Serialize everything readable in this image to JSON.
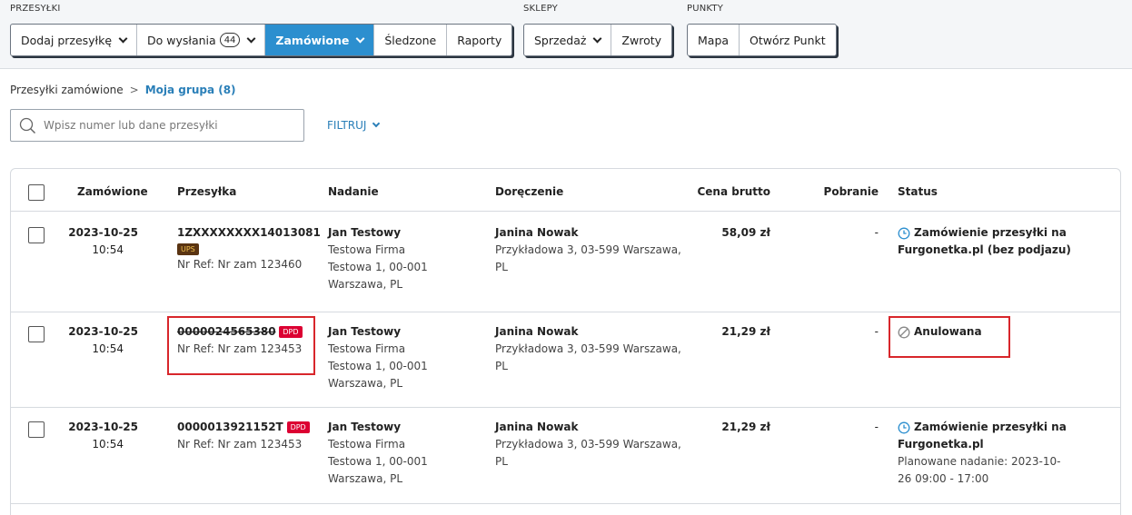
{
  "topbar": {
    "groups": [
      {
        "label": "PRZESYŁKI",
        "buttons": [
          "Dodaj przesyłkę",
          "Do wysłania",
          "Zamówione",
          "Śledzone",
          "Raporty"
        ],
        "to_send_count": "44"
      },
      {
        "label": "SKLEPY",
        "buttons": [
          "Sprzedaż",
          "Zwroty"
        ]
      },
      {
        "label": "PUNKTY",
        "buttons": [
          "Mapa",
          "Otwórz Punkt"
        ]
      }
    ]
  },
  "breadcrumb": {
    "parent": "Przesyłki zamówione",
    "separator": ">",
    "current": "Moja grupa (8)"
  },
  "search": {
    "placeholder": "Wpisz numer lub dane przesyłki"
  },
  "filter": {
    "label": "FILTRUJ"
  },
  "table": {
    "headers": [
      "Zamówione",
      "Przesyłka",
      "Nadanie",
      "Doręczenie",
      "Cena brutto",
      "Pobranie",
      "Status"
    ],
    "rows": [
      {
        "date": "2023-10-25",
        "time": "10:54",
        "tracking": "1ZXXXXXXXX14013081",
        "carrier": "UPS",
        "ref": "Nr Ref: Nr zam 123460",
        "sender": [
          "Jan Testowy",
          "Testowa Firma",
          "Testowa 1, 00-001",
          "Warszawa, PL"
        ],
        "recipient": [
          "Janina Nowak",
          "Przykładowa 3, 03-599 Warszawa,",
          "PL"
        ],
        "price": "58,09 zł",
        "cod": "-",
        "status": [
          "Zamówienie przesyłki na",
          "Furgonetka.pl (bez podjazu)"
        ]
      },
      {
        "date": "2023-10-25",
        "time": "10:54",
        "tracking": "0000024565380",
        "carrier": "DPD",
        "ref": "Nr Ref: Nr zam 123453",
        "sender": [
          "Jan Testowy",
          "Testowa Firma",
          "Testowa 1, 00-001",
          "Warszawa, PL"
        ],
        "recipient": [
          "Janina Nowak",
          "Przykładowa 3, 03-599 Warszawa,",
          "PL"
        ],
        "price": "21,29 zł",
        "cod": "-",
        "status": [
          "Anulowana"
        ]
      },
      {
        "date": "2023-10-25",
        "time": "10:54",
        "tracking": "0000013921152T",
        "carrier": "DPD",
        "ref": "Nr Ref: Nr zam 123453",
        "sender": [
          "Jan Testowy",
          "Testowa Firma",
          "Testowa 1, 00-001",
          "Warszawa, PL"
        ],
        "recipient": [
          "Janina Nowak",
          "Przykładowa 3, 03-599 Warszawa,",
          "PL"
        ],
        "price": "21,29 zł",
        "cod": "-",
        "status": [
          "Zamówienie przesyłki na",
          "Furgonetka.pl"
        ],
        "status_note": [
          "Planowane nadanie: 2023-10-",
          "26 09:00 - 17:00"
        ]
      }
    ]
  },
  "colors": {
    "accent": "#2c8fcf",
    "link": "#2a7fb8",
    "highlight": "#d8262b",
    "dpd": "#dc0032",
    "ups": "#5a3412"
  },
  "icons": [
    "chevron-down-icon",
    "search-icon",
    "clock-icon",
    "cancel-icon"
  ]
}
